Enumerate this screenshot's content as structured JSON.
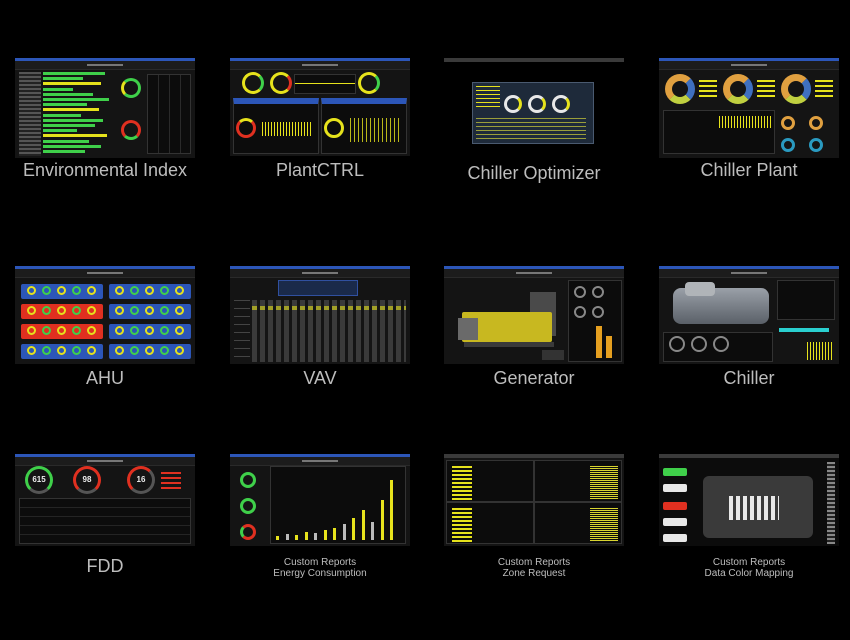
{
  "tiles": [
    {
      "id": "environmental-index",
      "label": "Environmental Index"
    },
    {
      "id": "plantctrl",
      "label": "PlantCTRL"
    },
    {
      "id": "chiller-optimizer",
      "label": "Chiller Optimizer"
    },
    {
      "id": "chiller-plant",
      "label": "Chiller Plant"
    },
    {
      "id": "ahu",
      "label": "AHU"
    },
    {
      "id": "vav",
      "label": "VAV"
    },
    {
      "id": "generator",
      "label": "Generator"
    },
    {
      "id": "chiller",
      "label": "Chiller"
    },
    {
      "id": "fdd",
      "label": "FDD",
      "gauges": [
        "615",
        "98",
        "16"
      ]
    },
    {
      "id": "energy-consumption",
      "label": "Custom Reports",
      "sublabel": "Energy Consumption"
    },
    {
      "id": "zone-request",
      "label": "Custom Reports",
      "sublabel": "Zone Request"
    },
    {
      "id": "data-color-mapping",
      "label": "Custom Reports",
      "sublabel": "Data Color Mapping"
    }
  ],
  "colors": {
    "yellow": "#e6e21c",
    "green": "#3fd04a",
    "red": "#e03020",
    "blue": "#2c56b8",
    "caption": "#bdbdbd"
  }
}
